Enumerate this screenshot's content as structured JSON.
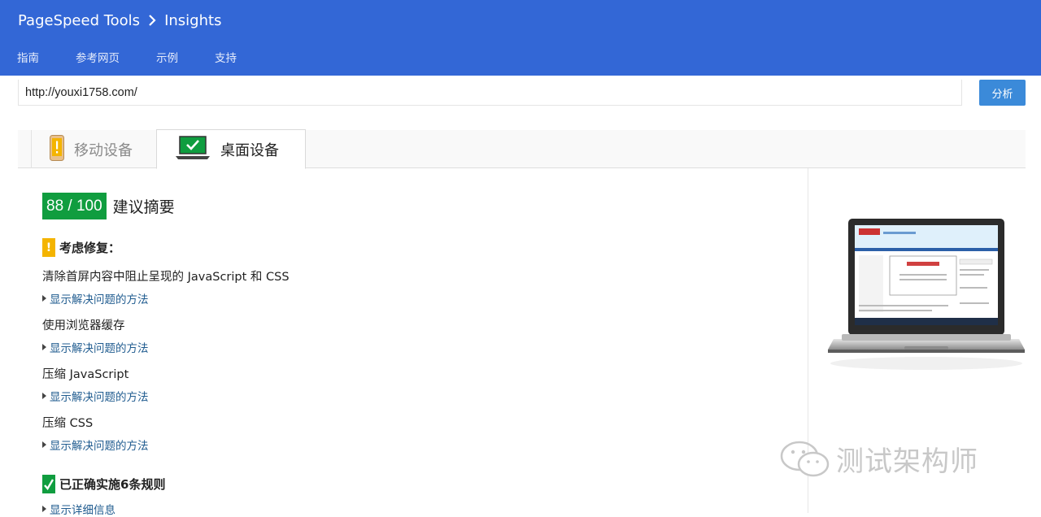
{
  "header": {
    "product": "PageSpeed Tools",
    "page": "Insights",
    "nav": [
      "指南",
      "参考网页",
      "示例",
      "支持"
    ],
    "color": "#3367d6"
  },
  "url_input": {
    "value": "http://youxi1758.com/"
  },
  "analyze_button": "分析",
  "tabs": [
    {
      "label": "移动设备",
      "icon": "mobile-warning-icon",
      "active": false
    },
    {
      "label": "桌面设备",
      "icon": "desktop-check-icon",
      "active": true
    }
  ],
  "summary": {
    "score": "88 / 100",
    "title": "建议摘要",
    "score_color": "#109d3f"
  },
  "consider_fixing": {
    "title": "考虑修复：",
    "rules": [
      {
        "title": "清除首屏内容中阻止呈现的 JavaScript 和 CSS",
        "link": "显示解决问题的方法"
      },
      {
        "title": "使用浏览器缓存",
        "link": "显示解决问题的方法"
      },
      {
        "title": "压缩 JavaScript",
        "link": "显示解决问题的方法"
      },
      {
        "title": "压缩 CSS",
        "link": "显示解决问题的方法"
      }
    ]
  },
  "passed": {
    "title": "已正确实施6条规则",
    "link": "显示详细信息"
  },
  "watermark": "测试架构师"
}
